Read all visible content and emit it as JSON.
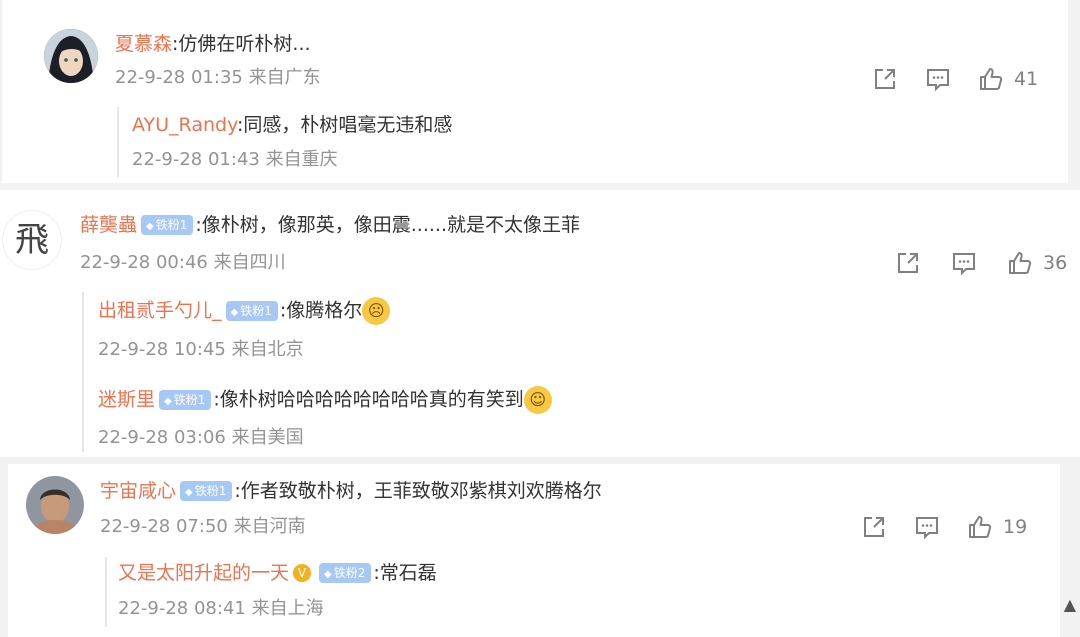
{
  "comments": [
    {
      "name": "夏慕森",
      "text": ":仿佛在听朴树...",
      "meta": "22-9-28 01:35 来自广东",
      "likes": "41",
      "replies": [
        {
          "name": "AYU_Randy",
          "text": ":同感，朴树唱毫无违和感",
          "meta": "22-9-28 01:43 来自重庆"
        }
      ]
    },
    {
      "name": "薛龑蟲",
      "badge": "铁粉1",
      "text": ":像朴树，像那英，像田震......就是不太像王菲",
      "meta": "22-9-28 00:46 来自四川",
      "likes": "36",
      "replies": [
        {
          "name": "出租贰手勺儿_",
          "badge": "铁粉1",
          "text": ":像腾格尔",
          "meta": "22-9-28 10:45 来自北京"
        },
        {
          "name": "迷斯里",
          "badge": "铁粉1",
          "text": ":像朴树哈哈哈哈哈哈哈哈真的有笑到",
          "meta": "22-9-28 03:06 来自美国"
        }
      ]
    },
    {
      "name": "宇宙咸心",
      "badge": "铁粉1",
      "text": ":作者致敬朴树，王菲致敬邓紫棋刘欢腾格尔",
      "meta": "22-9-28 07:50 来自河南",
      "likes": "19",
      "replies": [
        {
          "name": "又是太阳升起的一天",
          "badge": "铁粉2",
          "text": ":常石磊",
          "meta": "22-9-28 08:41 来自上海"
        }
      ]
    }
  ],
  "avatar2_text": "飛",
  "colors": {
    "name": "#eb7350",
    "meta": "#939393",
    "badge": "#a6c8f5"
  }
}
